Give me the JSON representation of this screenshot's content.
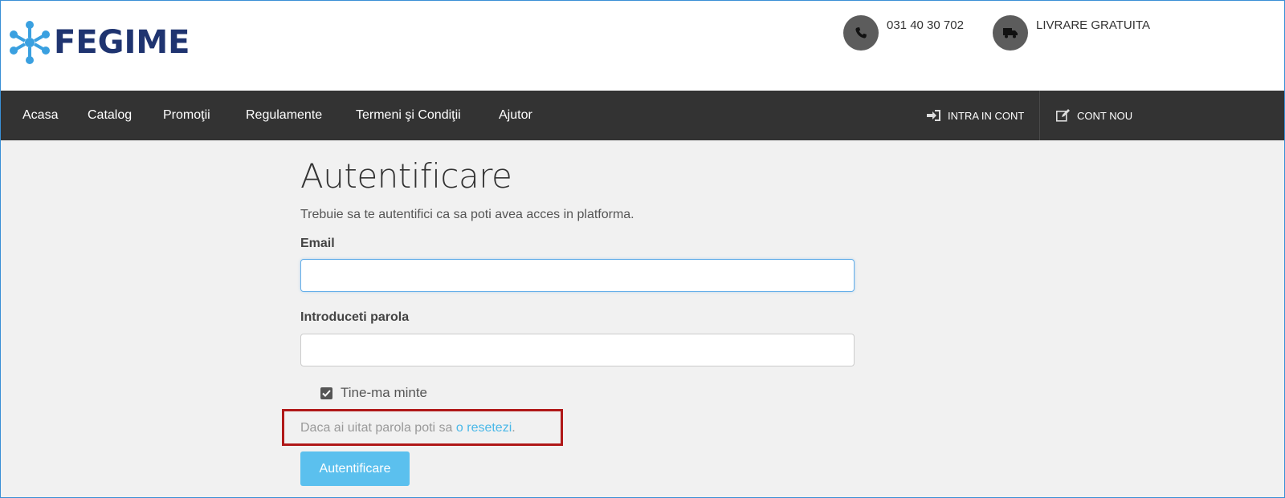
{
  "brand": {
    "name": "FEGIME"
  },
  "header": {
    "phone": "031 40 30 702",
    "delivery": "LIVRARE GRATUITA"
  },
  "nav": {
    "items": [
      "Acasa",
      "Catalog",
      "Promoţii",
      "Regulamente",
      "Termeni şi Condiţii",
      "Ajutor"
    ],
    "login": "INTRA IN CONT",
    "register": "CONT NOU"
  },
  "login": {
    "title": "Autentificare",
    "subtitle": "Trebuie sa te autentifici ca sa poti avea acces in platforma.",
    "email_label": "Email",
    "email_value": "",
    "password_label": "Introduceti parola",
    "password_value": "",
    "remember_label": "Tine-ma minte",
    "remember_checked": true,
    "forgot_prefix": "Daca ai uitat parola poti sa ",
    "forgot_link": "o resetezi",
    "forgot_suffix": ".",
    "submit_label": "Autentificare"
  },
  "colors": {
    "nav_bg": "#333333",
    "brand_blue": "#1f3470",
    "logo_accent": "#3aa0e0",
    "button": "#5bc0ee",
    "link": "#4ab8e8",
    "highlight_box": "#b01818"
  },
  "icons": [
    "phone-icon",
    "truck-icon",
    "sign-in-icon",
    "edit-icon",
    "check-icon"
  ]
}
